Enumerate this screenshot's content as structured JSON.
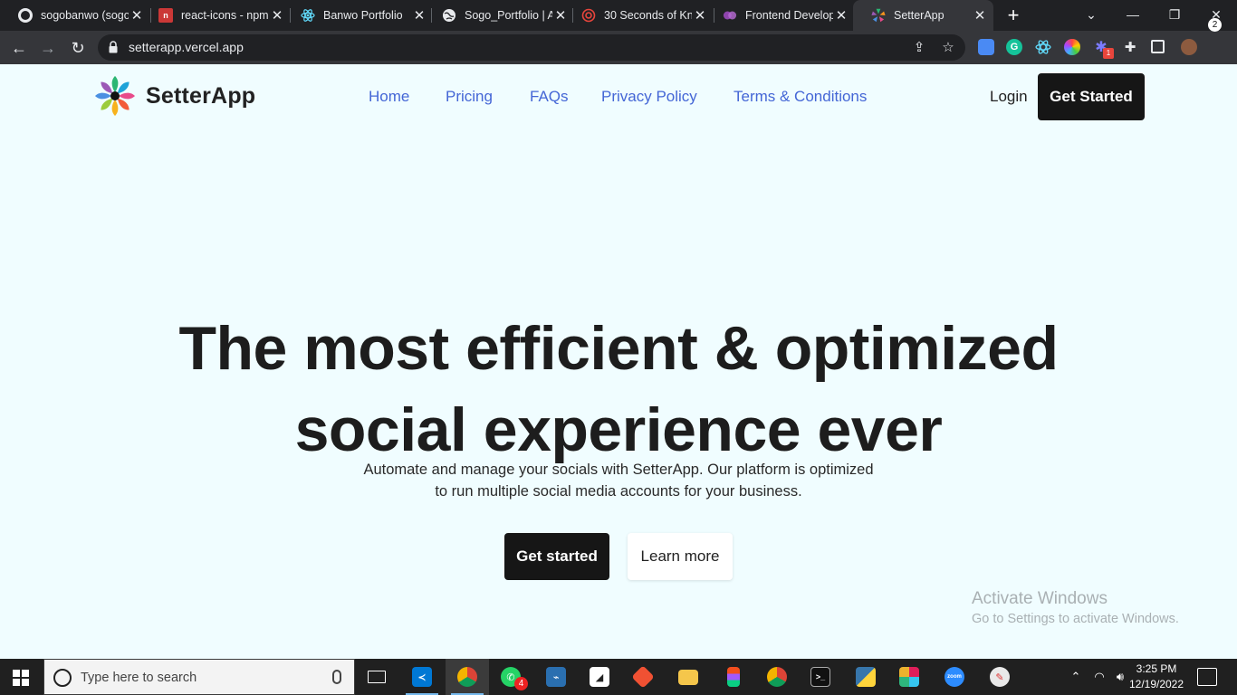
{
  "browser": {
    "tabs": [
      {
        "title": "sogobanwo (sogo",
        "icon": "github-icon",
        "color": "#202124"
      },
      {
        "title": "react-icons - npm",
        "icon": "npm-icon",
        "color": "#cb3837"
      },
      {
        "title": "Banwo Portfolio",
        "icon": "react-icon",
        "color": "#61dafb"
      },
      {
        "title": "Sogo_Portfolio | A",
        "icon": "globe-icon",
        "color": "#ffffff"
      },
      {
        "title": "30 Seconds of Kn",
        "icon": "spiral-icon",
        "color": "#e8453c"
      },
      {
        "title": "Frontend Develop",
        "icon": "circles-icon",
        "color": "#8e44ad"
      },
      {
        "title": "SetterApp",
        "icon": "setterapp-icon",
        "color": "#e84a8a"
      }
    ],
    "close_glyph": "✕",
    "new_tab_glyph": "+",
    "url": "setterapp.vercel.app"
  },
  "site": {
    "brand": "SetterApp",
    "nav": [
      "Home",
      "Pricing",
      "FAQs",
      "Privacy Policy",
      "Terms & Conditions"
    ],
    "login": "Login",
    "header_cta": "Get Started",
    "hero_title_line1": "The most efficient & optimized",
    "hero_title_line2": "social experience ever",
    "hero_sub_line1": "Automate and manage your socials with SetterApp. Our platform is optimized",
    "hero_sub_line2": "to run multiple social media accounts for your business.",
    "cta_primary": "Get started",
    "cta_secondary": "Learn more",
    "colors": {
      "nav_link": "#4466d6",
      "button_dark": "#161616",
      "page_bg": "#f0fdff"
    }
  },
  "watermark": {
    "title": "Activate Windows",
    "subtitle": "Go to Settings to activate Windows."
  },
  "taskbar": {
    "search_placeholder": "Type here to search",
    "whatsapp_badge": "4",
    "extension_badge": "1",
    "time": "3:25 PM",
    "date": "12/19/2022",
    "notifications": "2"
  }
}
